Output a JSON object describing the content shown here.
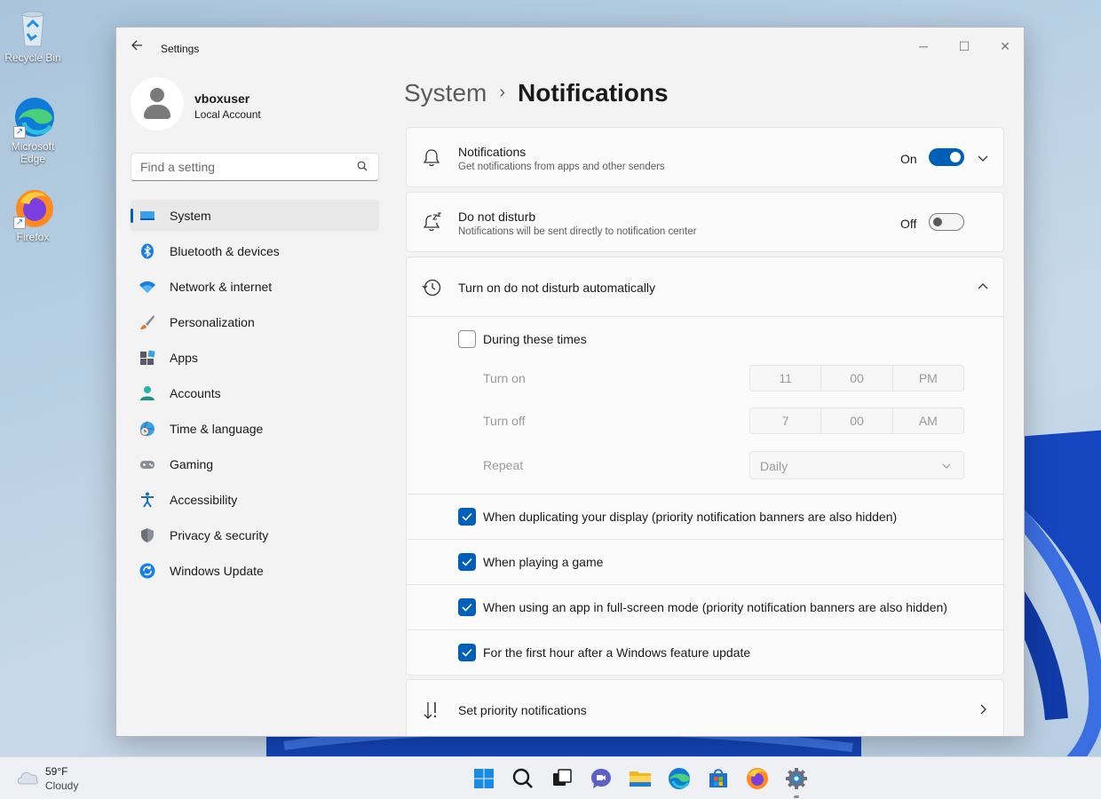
{
  "desktop": {
    "icons": [
      {
        "label": "Recycle Bin",
        "icon": "recycle-bin-icon"
      },
      {
        "label": "Microsoft Edge",
        "icon": "edge-icon"
      },
      {
        "label": "Firefox",
        "icon": "firefox-icon"
      }
    ]
  },
  "window": {
    "app_title": "Settings",
    "controls": {
      "minimize": "─",
      "maximize": "☐",
      "close": "✕"
    }
  },
  "profile": {
    "name": "vboxuser",
    "account_type": "Local Account"
  },
  "search": {
    "placeholder": "Find a setting"
  },
  "sidebar": {
    "items": [
      {
        "label": "System",
        "icon": "system-icon",
        "active": true
      },
      {
        "label": "Bluetooth & devices",
        "icon": "bluetooth-icon"
      },
      {
        "label": "Network & internet",
        "icon": "wifi-icon"
      },
      {
        "label": "Personalization",
        "icon": "brush-icon"
      },
      {
        "label": "Apps",
        "icon": "apps-icon"
      },
      {
        "label": "Accounts",
        "icon": "accounts-icon"
      },
      {
        "label": "Time & language",
        "icon": "globe-clock-icon"
      },
      {
        "label": "Gaming",
        "icon": "gamepad-icon"
      },
      {
        "label": "Accessibility",
        "icon": "accessibility-icon"
      },
      {
        "label": "Privacy & security",
        "icon": "shield-icon"
      },
      {
        "label": "Windows Update",
        "icon": "update-icon"
      }
    ]
  },
  "breadcrumb": {
    "parent": "System",
    "separator": "›",
    "current": "Notifications"
  },
  "notifications": {
    "title": "Notifications",
    "subtitle": "Get notifications from apps and other senders",
    "state": "On"
  },
  "dnd": {
    "title": "Do not disturb",
    "subtitle": "Notifications will be sent directly to notification center",
    "state": "Off"
  },
  "auto_dnd": {
    "title": "Turn on do not disturb automatically",
    "during_times": {
      "label": "During these times",
      "checked": false
    },
    "turn_on": {
      "label": "Turn on",
      "hour": "11",
      "minute": "00",
      "period": "PM"
    },
    "turn_off": {
      "label": "Turn off",
      "hour": "7",
      "minute": "00",
      "period": "AM"
    },
    "repeat": {
      "label": "Repeat",
      "value": "Daily"
    },
    "options": [
      {
        "label": "When duplicating your display (priority notification banners are also hidden)",
        "checked": true
      },
      {
        "label": "When playing a game",
        "checked": true
      },
      {
        "label": "When using an app in full-screen mode (priority notification banners are also hidden)",
        "checked": true
      },
      {
        "label": "For the first hour after a Windows feature update",
        "checked": true
      }
    ]
  },
  "priority": {
    "title": "Set priority notifications"
  },
  "taskbar": {
    "weather": {
      "temp": "59°F",
      "desc": "Cloudy"
    },
    "apps": [
      "start-icon",
      "search-icon",
      "task-view-icon",
      "chat-icon",
      "file-explorer-icon",
      "edge-icon",
      "store-icon",
      "firefox-icon",
      "settings-icon"
    ]
  },
  "colors": {
    "accent": "#005fb8"
  }
}
